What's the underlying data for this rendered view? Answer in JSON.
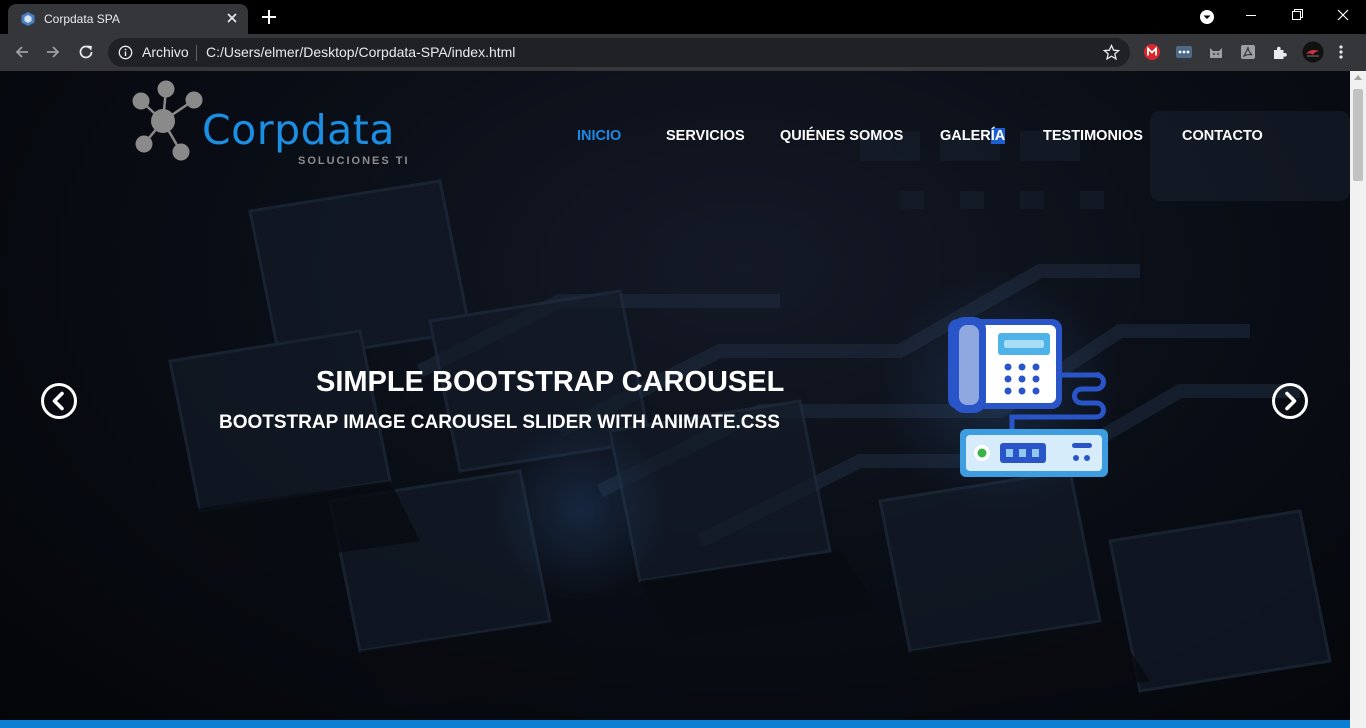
{
  "browser": {
    "tab_title": "Corpdata SPA",
    "address_prefix": "Archivo",
    "address_url": "C:/Users/elmer/Desktop/Corpdata-SPA/index.html"
  },
  "site": {
    "logo_text": "Corpdata",
    "logo_subtitle": "SOLUCIONES TI",
    "nav": [
      {
        "label": "INICIO",
        "active": true
      },
      {
        "label": "SERVICIOS",
        "active": false
      },
      {
        "label": "QUIÉNES SOMOS",
        "active": false
      },
      {
        "label_pre": "GALER",
        "label_hl": "ÍA",
        "active": false
      },
      {
        "label": "TESTIMONIOS",
        "active": false
      },
      {
        "label": "CONTACTO",
        "active": false
      }
    ],
    "hero": {
      "title": "SIMPLE BOOTSTRAP CAROUSEL",
      "subtitle": "BOOTSTRAP IMAGE CAROUSEL SLIDER WITH ANIMATE.CSS"
    }
  },
  "colors": {
    "accent": "#1e88e5",
    "logo": "#1a8fe3",
    "bottom_bar": "#0a7fd4"
  }
}
